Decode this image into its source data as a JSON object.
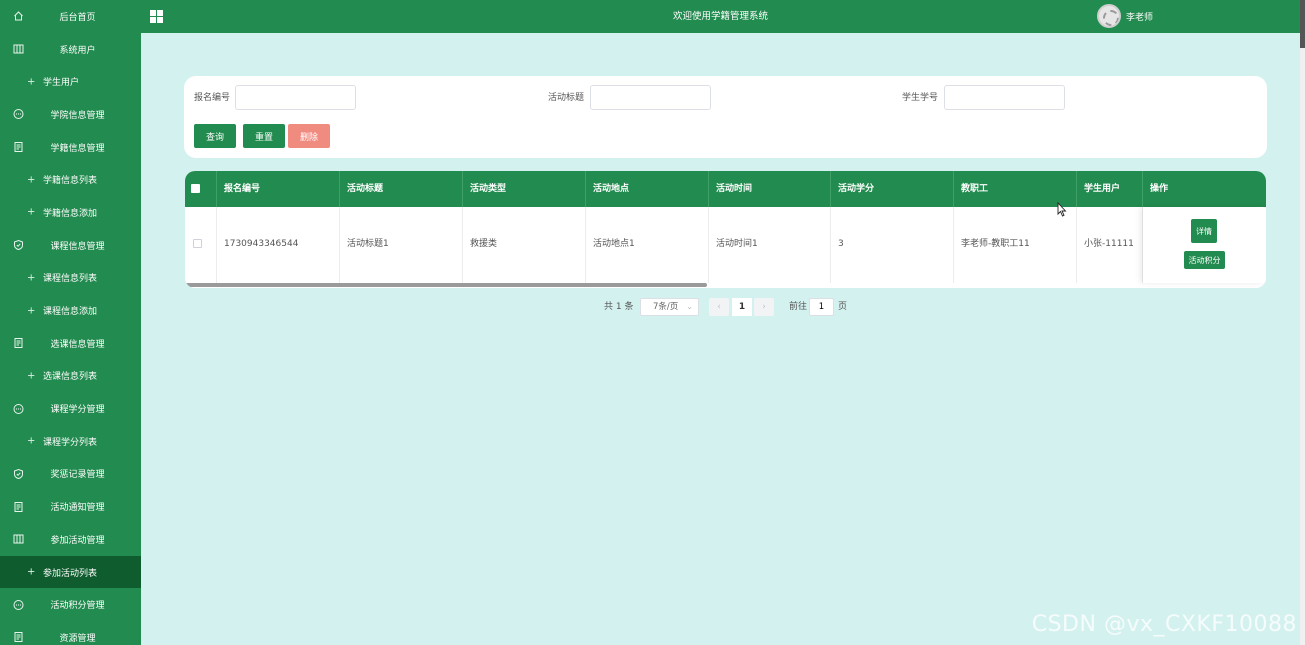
{
  "sidebar": {
    "items": [
      {
        "label": "后台首页",
        "icon": "home-icon",
        "sub": false
      },
      {
        "label": "系统用户",
        "icon": "columns-icon",
        "sub": false
      },
      {
        "label": "学生用户",
        "icon": "plus-icon",
        "sub": true
      },
      {
        "label": "学院信息管理",
        "icon": "chat-icon",
        "sub": false
      },
      {
        "label": "学籍信息管理",
        "icon": "document-icon",
        "sub": false
      },
      {
        "label": "学籍信息列表",
        "icon": "plus-icon",
        "sub": true
      },
      {
        "label": "学籍信息添加",
        "icon": "plus-icon",
        "sub": true
      },
      {
        "label": "课程信息管理",
        "icon": "shield-icon",
        "sub": false
      },
      {
        "label": "课程信息列表",
        "icon": "plus-icon",
        "sub": true
      },
      {
        "label": "课程信息添加",
        "icon": "plus-icon",
        "sub": true
      },
      {
        "label": "选课信息管理",
        "icon": "document-icon",
        "sub": false
      },
      {
        "label": "选课信息列表",
        "icon": "plus-icon",
        "sub": true
      },
      {
        "label": "课程学分管理",
        "icon": "chat-icon",
        "sub": false
      },
      {
        "label": "课程学分列表",
        "icon": "plus-icon",
        "sub": true
      },
      {
        "label": "奖惩记录管理",
        "icon": "shield-icon",
        "sub": false
      },
      {
        "label": "活动通知管理",
        "icon": "document-icon",
        "sub": false
      },
      {
        "label": "参加活动管理",
        "icon": "columns-icon",
        "sub": false
      },
      {
        "label": "参加活动列表",
        "icon": "plus-icon",
        "sub": true,
        "active": true
      },
      {
        "label": "活动积分管理",
        "icon": "chat-icon",
        "sub": false
      },
      {
        "label": "资源管理",
        "icon": "document-icon",
        "sub": false
      }
    ]
  },
  "topbar": {
    "title": "欢迎使用学籍管理系统",
    "user_name": "李老师"
  },
  "search": {
    "fields": [
      {
        "label": "报名编号",
        "value": "",
        "placeholder": ""
      },
      {
        "label": "活动标题",
        "value": "",
        "placeholder": ""
      },
      {
        "label": "学生学号",
        "value": "",
        "placeholder": ""
      }
    ],
    "buttons": {
      "query": "查询",
      "reset": "重置",
      "delete": "删除"
    }
  },
  "table": {
    "columns": [
      "报名编号",
      "活动标题",
      "活动类型",
      "活动地点",
      "活动时间",
      "活动学分",
      "教职工",
      "学生用户",
      "操作"
    ],
    "rows": [
      {
        "cells": [
          "1730943346544",
          "活动标题1",
          "救援类",
          "活动地点1",
          "活动时间1",
          "3",
          "李老师-教职工11",
          "小张-11111"
        ]
      }
    ],
    "actions": {
      "detail": "详情",
      "score": "活动积分"
    }
  },
  "pagination": {
    "total_text": "共 1 条",
    "page_size": "7条/页",
    "prev": "‹",
    "current_page": "1",
    "next": "›",
    "goto_prefix": "前往",
    "goto_value": "1",
    "goto_suffix": "页"
  },
  "watermark": "CSDN @vx_CXKF10088",
  "colors": {
    "primary": "#228b4f",
    "active": "#0f5d2e",
    "background": "#d3f1ef",
    "danger": "#f08b80"
  }
}
